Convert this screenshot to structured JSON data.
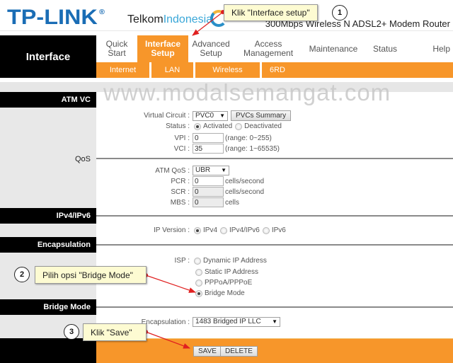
{
  "header": {
    "brand": "TP-LINK",
    "brand_mark": "®",
    "isp_logo_part1": "Telkom",
    "isp_logo_part2": "Indonesia",
    "model": "300Mbps Wireless N ADSL2+ Modem Router"
  },
  "nav": {
    "section_title": "Interface",
    "tabs": [
      {
        "label": "Quick Start",
        "active": false
      },
      {
        "label": "Interface Setup",
        "active": true
      },
      {
        "label": "Advanced Setup",
        "active": false
      },
      {
        "label": "Access Management",
        "active": false
      },
      {
        "label": "Maintenance",
        "active": false
      },
      {
        "label": "Status",
        "active": false
      },
      {
        "label": "Help",
        "active": false
      }
    ],
    "subtabs": [
      {
        "label": "Internet",
        "active": true
      },
      {
        "label": "LAN",
        "active": false
      },
      {
        "label": "Wireless",
        "active": false
      },
      {
        "label": "6RD",
        "active": false
      }
    ]
  },
  "watermark": "www.modalsemangat.com",
  "sections": {
    "atm_vc": "ATM VC",
    "qos": "QoS",
    "ip_version": "IPv4/IPv6",
    "encapsulation": "Encapsulation",
    "bridge_mode": "Bridge Mode"
  },
  "atm_vc": {
    "virtual_circuit_label": "Virtual Circuit :",
    "virtual_circuit_value": "PVC0",
    "pvcs_summary_button": "PVCs Summary",
    "status_label": "Status :",
    "status_options": [
      {
        "label": "Activated",
        "selected": true
      },
      {
        "label": "Deactivated",
        "selected": false
      }
    ],
    "vpi_label": "VPI :",
    "vpi_value": "0",
    "vpi_range": "(range: 0~255)",
    "vci_label": "VCI :",
    "vci_value": "35",
    "vci_range": "(range: 1~65535)"
  },
  "qos": {
    "atm_qos_label": "ATM QoS :",
    "atm_qos_value": "UBR",
    "pcr_label": "PCR :",
    "pcr_value": "0",
    "pcr_unit": "cells/second",
    "scr_label": "SCR :",
    "scr_value": "0",
    "scr_unit": "cells/second",
    "mbs_label": "MBS :",
    "mbs_value": "0",
    "mbs_unit": "cells"
  },
  "ip_version": {
    "label": "IP Version :",
    "options": [
      {
        "label": "IPv4",
        "selected": true
      },
      {
        "label": "IPv4/IPv6",
        "selected": false
      },
      {
        "label": "IPv6",
        "selected": false
      }
    ]
  },
  "encapsulation": {
    "isp_label": "ISP :",
    "isp_options": [
      {
        "label": "Dynamic IP Address",
        "selected": false
      },
      {
        "label": "Static IP Address",
        "selected": false
      },
      {
        "label": "PPPoA/PPPoE",
        "selected": false
      },
      {
        "label": "Bridge Mode",
        "selected": true
      }
    ]
  },
  "bridge_mode": {
    "encapsulation_label": "Encapsulation :",
    "encapsulation_value": "1483 Bridged IP LLC"
  },
  "footer": {
    "save_label": "SAVE",
    "delete_label": "DELETE"
  },
  "annotations": [
    {
      "number": "1",
      "text": "Klik \"Interface setup\""
    },
    {
      "number": "2",
      "text": "Pilih opsi \"Bridge Mode\""
    },
    {
      "number": "3",
      "text": "Klik \"Save\""
    }
  ],
  "colors": {
    "accent_orange": "#f7962a",
    "brand_blue": "#1a6db5",
    "callout_bg": "#fdfbd2",
    "arrow_red": "#e02020"
  }
}
